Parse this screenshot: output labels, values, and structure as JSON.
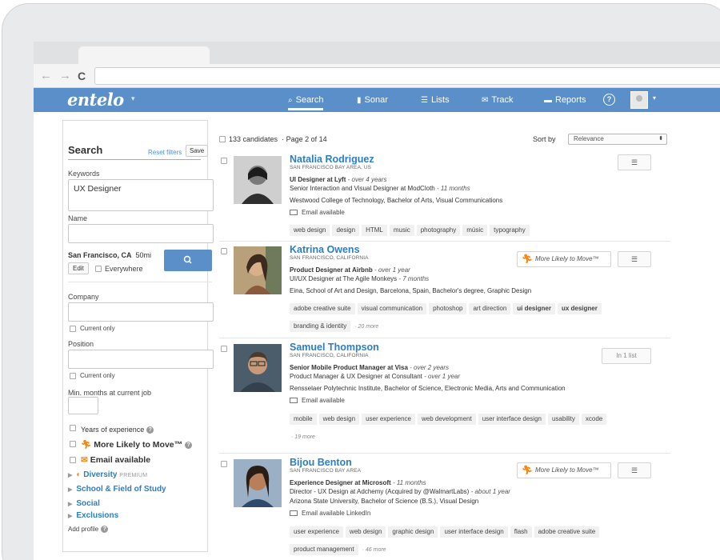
{
  "nav": {
    "logo": "entelo",
    "items": [
      {
        "icon": "⌕",
        "label": "Search"
      },
      {
        "icon": "▮",
        "label": "Sonar"
      },
      {
        "icon": "☰",
        "label": "Lists"
      },
      {
        "icon": "✉",
        "label": "Track"
      },
      {
        "icon": "▬",
        "label": "Reports"
      }
    ],
    "help": "?"
  },
  "sidebar": {
    "title": "Search",
    "reset": "Reset filters",
    "save": "Save",
    "keywords_label": "Keywords",
    "keywords_value": "UX Designer",
    "name_label": "Name",
    "location": "San Francisco, CA",
    "radius": "50mi",
    "edit": "Edit",
    "everywhere": "Everywhere",
    "company_label": "Company",
    "current_only": "Current only",
    "position_label": "Position",
    "min_months_label": "Min. months at current job",
    "years_exp": "Years of experience",
    "more_likely": "More Likely to Move™",
    "email_available": "Email available",
    "diversity": "Diversity",
    "premium": "PREMIUM",
    "school": "School & Field of Study",
    "social": "Social",
    "exclusions": "Exclusions",
    "add_profile": "Add profile"
  },
  "results": {
    "count": "133 candidates",
    "page": "· Page 2 of 14",
    "sort_label": "Sort by",
    "sort_value": "Relevance",
    "mlm_label": "More Likely to Move™",
    "candidates": [
      {
        "name": "Natalia Rodriguez",
        "location": "SAN FRANCISCO BAY AREA, US",
        "title": "UI Designer at Lyft",
        "title_dur": " - over 4 years",
        "prev": "Senior Interaction and Visual Designer at ModCloth",
        "prev_dur": " - 11 months",
        "edu": "Westwood College of Technology, Bachelor of Arts, Visual Communications",
        "email": "Email available",
        "tags": [
          "web design",
          "design",
          "HTML",
          "music",
          "photography",
          "músic",
          "typography"
        ],
        "more": "",
        "list_label": ""
      },
      {
        "name": "Katrina Owens",
        "location": "SAN FRANCISCO, CALIFORNIA",
        "title": "Product Designer at Airbnb",
        "title_dur": " - over 1 year",
        "prev": "UI/UX Designer at The Agile Monkeys",
        "prev_dur": " - 7 months",
        "edu": "Eina, School of Art and Design, Barcelona, Spain, Bachelor's degree, Graphic Design",
        "email": "",
        "tags": [
          "adobe creative suite",
          "visual communication",
          "photoshop",
          "art direction",
          "ui designer",
          "ux designer",
          "branding & identity"
        ],
        "bold_tags": [
          "ui designer",
          "ux designer"
        ],
        "more": "· 20 more",
        "list_label": ""
      },
      {
        "name": "Samuel Thompson",
        "location": "SAN FRANCISCO, CALIFORNIA",
        "title": "Senior Mobile Product Manager at Visa",
        "title_dur": " - over 2 years",
        "prev": "Product Manager & UX Designer at Consultant",
        "prev_dur": " - over 1 year",
        "edu": "Rensselaer Polytechnic Institute, Bachelor of Science, Electronic Media, Arts and Communication",
        "email": "Email available",
        "tags": [
          "mobile",
          "web design",
          "user experience",
          "web development",
          "user interface design",
          "usability",
          "xcode"
        ],
        "more": "· 19 more",
        "list_label": "In 1 list"
      },
      {
        "name": "Bijou Benton",
        "location": "SAN FRANCISCO BAY AREA",
        "title": "Experience Designer at Microsoft",
        "title_dur": " - 11 months",
        "prev": "Director - UX Design at Adchemy (Acquired by @WalmartLabs)",
        "prev_dur": " - about 1 year",
        "edu": "Arizona State University, Bachelor of Science (B.S.), Visual Design",
        "email": "Email available LinkedIn",
        "tags": [
          "user experience",
          "web design",
          "graphic design",
          "user interface design",
          "flash",
          "adobe creative suite",
          "product management"
        ],
        "more": "· 46 more",
        "list_label": ""
      }
    ]
  },
  "colors": {
    "brand": "#5b8fc9",
    "link": "#2b7ec4",
    "accent": "#f08a1d"
  }
}
